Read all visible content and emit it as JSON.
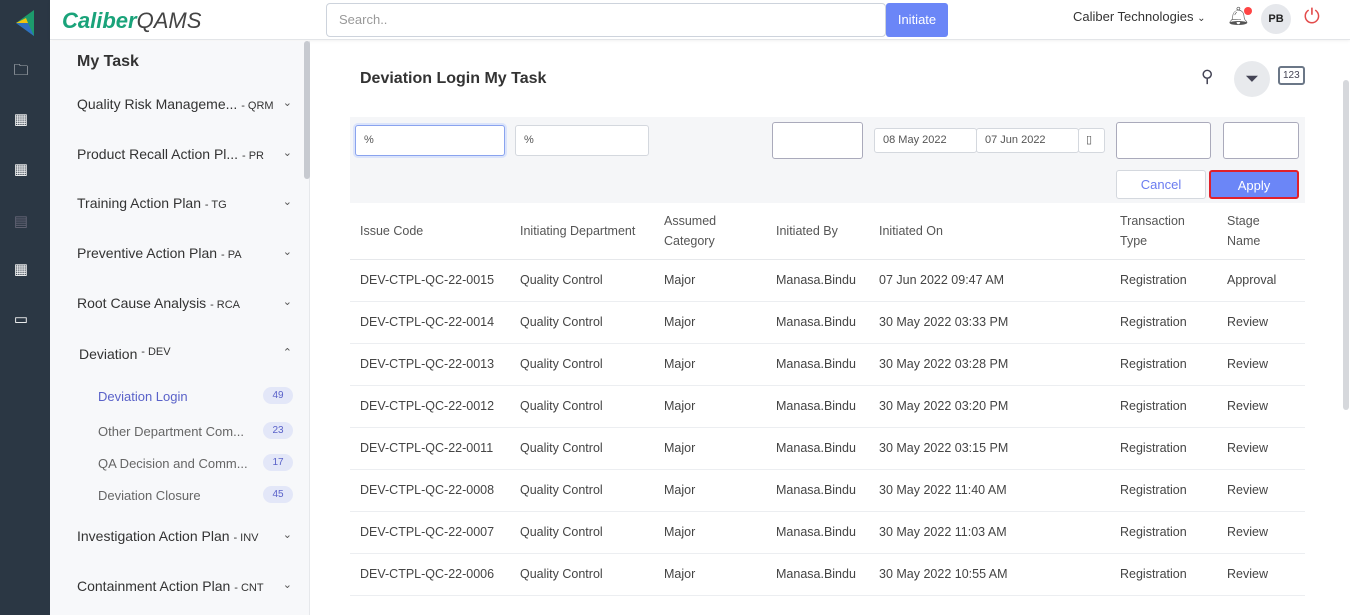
{
  "header": {
    "logo_brand": "Caliber",
    "logo_product": "QAMS",
    "search_placeholder": "Search..",
    "initiate": "Initiate",
    "org": "Caliber Technologies",
    "avatar": "PB"
  },
  "sidebar": {
    "title": "My Task",
    "modules": [
      {
        "label": "Quality Risk Manageme...",
        "code": "- QRM"
      },
      {
        "label": "Product Recall Action Pl...",
        "code": "- PR"
      },
      {
        "label": "Training Action Plan",
        "code": "- TG"
      },
      {
        "label": "Preventive Action Plan",
        "code": "- PA"
      },
      {
        "label": "Root Cause Analysis",
        "code": "- RCA"
      },
      {
        "label": "Deviation",
        "code": "- DEV"
      },
      {
        "label": "Investigation Action Plan",
        "code": "- INV"
      },
      {
        "label": "Containment Action Plan",
        "code": "- CNT"
      }
    ],
    "sub": [
      {
        "label": "Deviation Login",
        "count": "49"
      },
      {
        "label": "Other Department Com...",
        "count": "23"
      },
      {
        "label": "QA Decision and Comm...",
        "count": "17"
      },
      {
        "label": "Deviation Closure",
        "count": "45"
      }
    ]
  },
  "main": {
    "title": "Deviation Login My Task",
    "filters": {
      "issue_code": "%",
      "department": "%",
      "from_date": "08 May 2022",
      "to_date": "07 Jun 2022"
    },
    "cancel": "Cancel",
    "apply": "Apply",
    "columns": [
      "Issue Code",
      "Initiating Department",
      "Assumed Category",
      "Initiated By",
      "Initiated On",
      "Transaction Type",
      "Stage Name"
    ],
    "rows": [
      [
        "DEV-CTPL-QC-22-0015",
        "Quality Control",
        "Major",
        "Manasa.Bindu",
        "07 Jun 2022 09:47 AM",
        "Registration",
        "Approval"
      ],
      [
        "DEV-CTPL-QC-22-0014",
        "Quality Control",
        "Major",
        "Manasa.Bindu",
        "30 May 2022 03:33 PM",
        "Registration",
        "Review"
      ],
      [
        "DEV-CTPL-QC-22-0013",
        "Quality Control",
        "Major",
        "Manasa.Bindu",
        "30 May 2022 03:28 PM",
        "Registration",
        "Review"
      ],
      [
        "DEV-CTPL-QC-22-0012",
        "Quality Control",
        "Major",
        "Manasa.Bindu",
        "30 May 2022 03:20 PM",
        "Registration",
        "Review"
      ],
      [
        "DEV-CTPL-QC-22-0011",
        "Quality Control",
        "Major",
        "Manasa.Bindu",
        "30 May 2022 03:15 PM",
        "Registration",
        "Review"
      ],
      [
        "DEV-CTPL-QC-22-0008",
        "Quality Control",
        "Major",
        "Manasa.Bindu",
        "30 May 2022 11:40 AM",
        "Registration",
        "Review"
      ],
      [
        "DEV-CTPL-QC-22-0007",
        "Quality Control",
        "Major",
        "Manasa.Bindu",
        "30 May 2022 11:03 AM",
        "Registration",
        "Review"
      ],
      [
        "DEV-CTPL-QC-22-0006",
        "Quality Control",
        "Major",
        "Manasa.Bindu",
        "30 May 2022 10:55 AM",
        "Registration",
        "Review"
      ]
    ]
  }
}
